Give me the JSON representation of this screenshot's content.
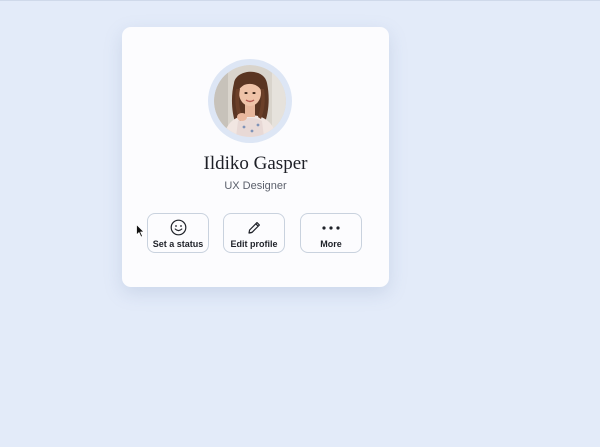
{
  "profile": {
    "name": "Ildiko Gasper",
    "role": "UX Designer",
    "avatar_icon": "profile-photo"
  },
  "actions": [
    {
      "label": "Set a status",
      "icon": "smiley-icon"
    },
    {
      "label": "Edit profile",
      "icon": "pencil-icon"
    },
    {
      "label": "More",
      "icon": "more-dots-icon"
    }
  ],
  "colors": {
    "background": "#e3ebf9",
    "card": "#fcfcfe",
    "avatar_ring": "#dde6f5",
    "button_border": "#c9d2de",
    "text_primary": "#1d1f26",
    "text_secondary": "#5a5f6b"
  }
}
